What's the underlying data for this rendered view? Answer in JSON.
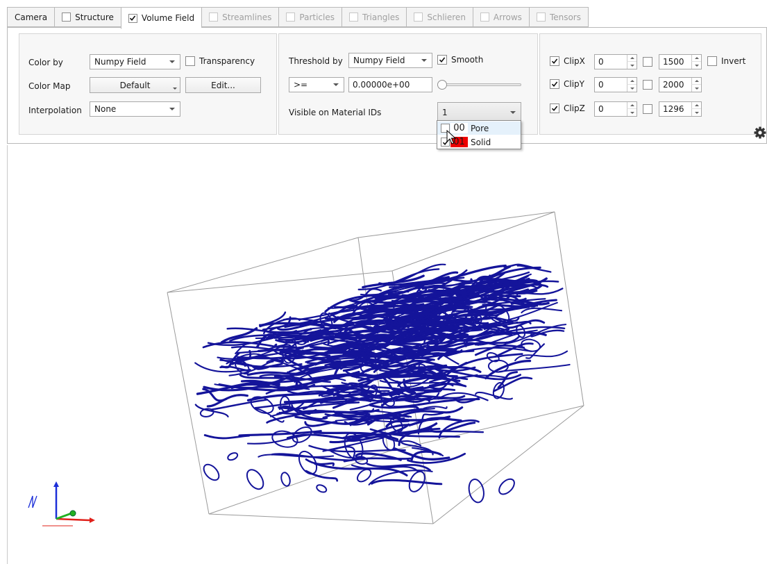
{
  "tabs": [
    {
      "label": "Camera",
      "has_checkbox": false,
      "checked": false,
      "enabled": true,
      "active": false
    },
    {
      "label": "Structure",
      "has_checkbox": true,
      "checked": false,
      "enabled": true,
      "active": false
    },
    {
      "label": "Volume Field",
      "has_checkbox": true,
      "checked": true,
      "enabled": true,
      "active": true
    },
    {
      "label": "Streamlines",
      "has_checkbox": true,
      "checked": false,
      "enabled": false,
      "active": false
    },
    {
      "label": "Particles",
      "has_checkbox": true,
      "checked": false,
      "enabled": false,
      "active": false
    },
    {
      "label": "Triangles",
      "has_checkbox": true,
      "checked": false,
      "enabled": false,
      "active": false
    },
    {
      "label": "Schlieren",
      "has_checkbox": true,
      "checked": false,
      "enabled": false,
      "active": false
    },
    {
      "label": "Arrows",
      "has_checkbox": true,
      "checked": false,
      "enabled": false,
      "active": false
    },
    {
      "label": "Tensors",
      "has_checkbox": true,
      "checked": false,
      "enabled": false,
      "active": false
    }
  ],
  "color_group": {
    "color_by_label": "Color by",
    "color_by_value": "Numpy Field",
    "transparency_label": "Transparency",
    "transparency_checked": false,
    "color_map_label": "Color Map",
    "color_map_value": "Default",
    "edit_label": "Edit...",
    "interpolation_label": "Interpolation",
    "interpolation_value": "None"
  },
  "threshold_group": {
    "threshold_by_label": "Threshold by",
    "threshold_by_value": "Numpy Field",
    "smooth_label": "Smooth",
    "smooth_checked": true,
    "operator_value": ">=",
    "threshold_value": "0.00000e+00",
    "slider_level": 0,
    "visible_ids_label": "Visible on Material IDs",
    "visible_ids_value": "1",
    "material_options": [
      {
        "id": "00",
        "name": "Pore",
        "checked": false,
        "color": "#ffffff"
      },
      {
        "id": "01",
        "name": "Solid",
        "checked": true,
        "color": "#ee0000"
      }
    ]
  },
  "clip_group": {
    "rows": [
      {
        "label": "ClipX",
        "checked": true,
        "min": "0",
        "max_checked": false,
        "max": "1500"
      },
      {
        "label": "ClipY",
        "checked": true,
        "min": "0",
        "max_checked": false,
        "max": "2000"
      },
      {
        "label": "ClipZ",
        "checked": true,
        "min": "0",
        "max_checked": false,
        "max": "1296"
      }
    ],
    "invert_label": "Invert",
    "invert_checked": false
  },
  "colors": {
    "fiber": "#14149a",
    "box": "#9a9a9a",
    "axis_x": "#e0201a",
    "axis_y": "#22b022",
    "axis_z": "#1c2fd8"
  },
  "icons": {
    "gear": "gear-icon",
    "check": "check-icon"
  }
}
